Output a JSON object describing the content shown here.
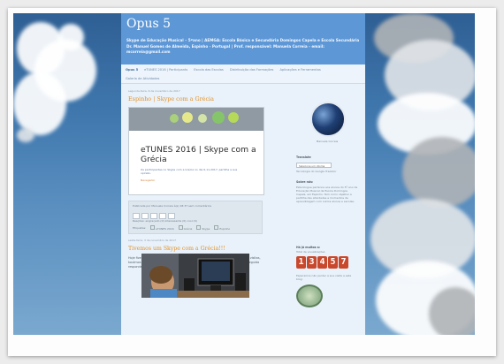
{
  "blog": {
    "title": "Opus 5",
    "description": "Skype de Educação Musical – 5ºano | AEMGA: Escola Básica e Secundária Domingos Capela e Escola Secundária Dr. Manuel Gomes de Almeida, Espinho - Portugal | Prof. responsável: Manuela Correia - email: mcorreia@gmail.com"
  },
  "nav": {
    "items": [
      "Opus 5",
      "eTUNES 2016 | Participants",
      "Escola das Escolas",
      "Distribuição das Formações",
      "Aplicações e Ferramentas",
      "Galeria de Atividades"
    ]
  },
  "post1": {
    "date": "segunda-feira, 6 de novembro de 2017",
    "title": "Espinho | Skype com a Grécia",
    "embed_heading": "eTUNES 2016 | Skype com a Grécia",
    "embed_sub": "Os participantes no Skype com a Grécia no dia 6-11-2017, partilha a sua opinião.",
    "embed_link": "Navegador",
    "meta": "Publicada por Manuela Correia à(s) 18:37 sem comentários",
    "reactions": "Reações: engraçado (0) interessante (0) cool (0)",
    "labels": [
      "eTUNES 2016",
      "Grécia",
      "Skype",
      "Espinho"
    ],
    "labels_prefix": "Etiquetas:"
  },
  "post2": {
    "date": "sexta-feira, 3 de novembro de 2017",
    "title": "Tivemos um Skype com a Grécia!!!",
    "body": "Hoje fizemos um Skype com a Grécia. Depois das devidas apresentações e duas visitas, tocámos e dois pais, cantámos o hino nacional, o que foi muito agradável e de seguida respondemos a perguntas."
  },
  "sidebar": {
    "profile_caption": "Manuela Correia",
    "translate_heading": "Translate",
    "translate_select": "Selecione um idioma",
    "translate_note": "Tecnologia do Google Tradutor",
    "about_heading": "Sobre nós:",
    "about_text": "Este blogue pertence aos alunos do 5º ano de Educação Musical da Escola Domingos Capela, em Espinho. Tem como objetivo a partilha das atividades e momentos de aprendizagem com outros alunos e escolas.",
    "visits_heading": "Há já muitos a:",
    "visits_note": "Total de visualizações",
    "counter_digits": [
      "1",
      "3",
      "4",
      "5",
      "7"
    ],
    "counter_accent": "#c9482c",
    "partners_heading": "Esperamos não perder a sua visita a este blog:"
  },
  "colors": {
    "header": "#5d97d6",
    "post_title": "#e2912a"
  }
}
